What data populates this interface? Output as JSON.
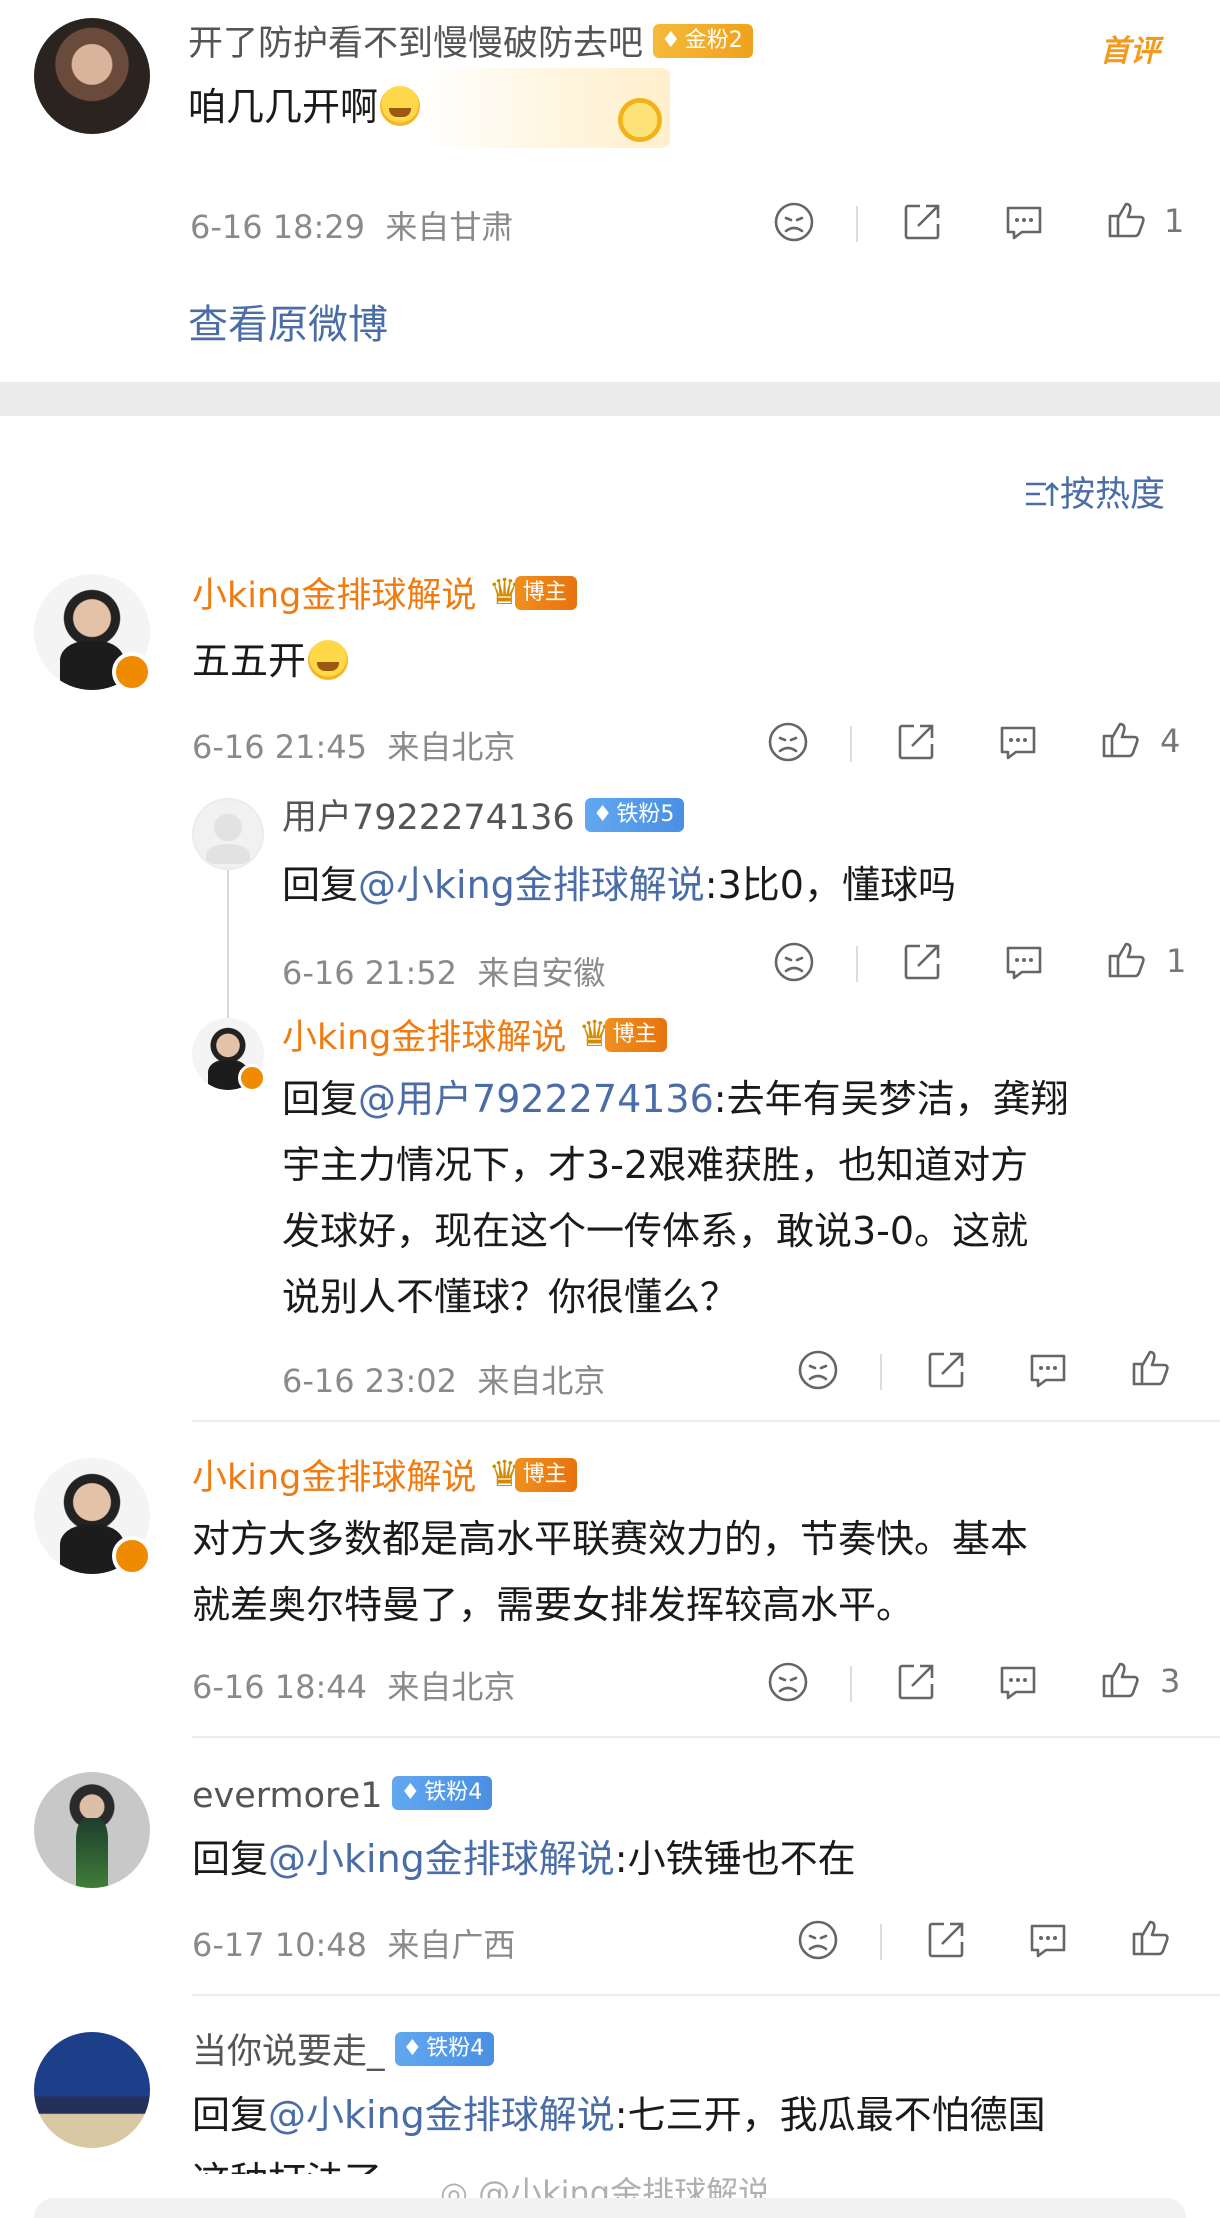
{
  "top_comment": {
    "username": "开了防护看不到慢慢破防去吧",
    "fan_badge": "金粉2",
    "text": "咱几几开啊",
    "time": "6-16 18:29",
    "location": "来自甘肃",
    "likes": "1",
    "first_label": "首评"
  },
  "view_original": "查看原微博",
  "sort_label": "按热度",
  "comments": [
    {
      "username": "小king金排球解说",
      "badge": "博主",
      "text": "五五开",
      "time": "6-16 21:45",
      "location": "来自北京",
      "likes": "4",
      "replies": [
        {
          "username": "用户7922274136",
          "badge": "铁粉5",
          "prefix": "回复",
          "mention": "@小king金排球解说",
          "text": ":3比0，懂球吗",
          "time": "6-16 21:52",
          "location": "来自安徽",
          "likes": "1"
        },
        {
          "username": "小king金排球解说",
          "badge": "博主",
          "prefix": "回复",
          "mention": "@用户7922274136",
          "text_lines": [
            ":去年有吴梦洁，龚翔",
            "宇主力情况下，才3-2艰难获胜，也知道对方",
            "发球好，现在这个一传体系，敢说3-0。这就",
            "说别人不懂球？你很懂么？"
          ],
          "time": "6-16 23:02",
          "location": "来自北京",
          "likes": ""
        }
      ]
    },
    {
      "username": "小king金排球解说",
      "badge": "博主",
      "text_lines": [
        "对方大多数都是高水平联赛效力的，节奏快。基本",
        "就差奥尔特曼了，需要女排发挥较高水平。"
      ],
      "time": "6-16 18:44",
      "location": "来自北京",
      "likes": "3"
    },
    {
      "username": "evermore1",
      "badge": "铁粉4",
      "prefix": "回复",
      "mention": "@小king金排球解说",
      "text": ":小铁锤也不在",
      "time": "6-17 10:48",
      "location": "来自广西",
      "likes": ""
    },
    {
      "username": "当你说要走_",
      "badge": "铁粉4",
      "prefix": "回复",
      "mention": "@小king金排球解说",
      "text": ":七三开，我瓜最不怕德国",
      "text_cut": "这种打法了",
      "time": "",
      "location": "",
      "likes": ""
    }
  ],
  "watermark": "@小king金排球解说",
  "icons": [
    "dislike-icon",
    "share-icon",
    "comment-icon",
    "like-icon",
    "sort-icon",
    "verified-icon",
    "crown-icon"
  ],
  "colors": {
    "accent_orange": "#f07b10",
    "link_blue": "#4a6da7",
    "meta_gray": "#8a8a8a"
  }
}
